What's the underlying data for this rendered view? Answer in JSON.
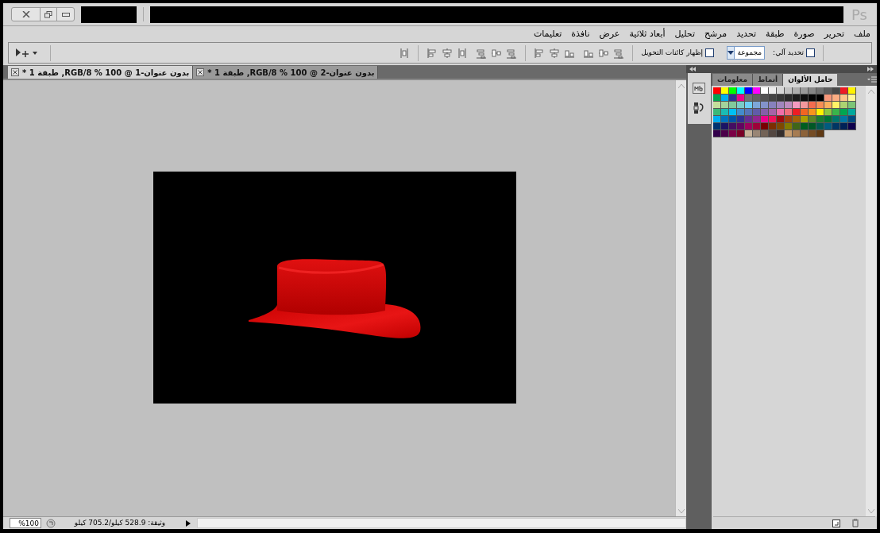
{
  "title_bar": {
    "logo": "Ps"
  },
  "menu": [
    "ملف",
    "تحرير",
    "صورة",
    "طبقة",
    "تحديد",
    "مرشح",
    "تحليل",
    "أبعاد ثلاثية",
    "عرض",
    "نافذة",
    "تعليمات"
  ],
  "options_bar": {
    "auto_select": {
      "label": "تحديد آلي:",
      "checked": false
    },
    "auto_select_target": {
      "value": "مجموعة"
    },
    "show_transform": {
      "label": "إظهار كائنات التحويل",
      "checked": false
    }
  },
  "tabs": [
    {
      "label": "بدون عنوان-2 @ 100 % RGB/8, طبقة 1 *",
      "selected": false
    },
    {
      "label": "بدون عنوان-1 @ 100 % RGB/8, طبقة 1 *",
      "selected": true
    }
  ],
  "panel": {
    "tabs": [
      {
        "label": "حامل الألوان",
        "selected": true
      },
      {
        "label": "أنماط",
        "selected": false
      },
      {
        "label": "معلومات",
        "selected": false
      }
    ],
    "swatch_rows": [
      [
        {
          "color": "#ff0000"
        },
        {
          "color": "#ffff00"
        },
        {
          "color": "#00ff00"
        },
        {
          "color": "#00ffff"
        },
        {
          "color": "#0000ff"
        },
        {
          "color": "#ff00ff"
        },
        {
          "color": "#ffffff"
        },
        {
          "color": "#ebebeb"
        },
        {
          "color": "#d6d6d6"
        },
        {
          "color": "#c2c2c2"
        },
        {
          "color": "#adadad"
        },
        {
          "color": "#999999"
        },
        {
          "color": "#858585"
        },
        {
          "color": "#707070"
        },
        {
          "color": "#5c5c5c"
        },
        {
          "color": "#474747"
        },
        {
          "color": "#ed1c24"
        },
        {
          "color": "#fff200"
        }
      ],
      [
        {
          "color": "#00a651"
        },
        {
          "color": "#00aeef"
        },
        {
          "color": "#2e3192"
        },
        {
          "color": "#ec008c"
        },
        {
          "color": "#707070"
        },
        {
          "color": "#616161"
        },
        {
          "color": "#525252"
        },
        {
          "color": "#434343"
        },
        {
          "color": "#363636"
        },
        {
          "color": "#292929"
        },
        {
          "color": "#1c1c1c"
        },
        {
          "color": "#0f0f0f"
        },
        {
          "color": "#050505"
        },
        {
          "color": "#000000"
        },
        {
          "color": "#f7977a"
        },
        {
          "color": "#fbad82"
        },
        {
          "color": "#fdc68a"
        },
        {
          "color": "#fff799"
        }
      ],
      [
        {
          "color": "#c4df9b"
        },
        {
          "color": "#a3d39c"
        },
        {
          "color": "#82ca9c"
        },
        {
          "color": "#7accc8"
        },
        {
          "color": "#6dcff6"
        },
        {
          "color": "#7da7d9"
        },
        {
          "color": "#8393ca"
        },
        {
          "color": "#8781bd"
        },
        {
          "color": "#a186be"
        },
        {
          "color": "#bd8cbf"
        },
        {
          "color": "#f49ac1"
        },
        {
          "color": "#f5989d"
        },
        {
          "color": "#f26c4f"
        },
        {
          "color": "#f68e55"
        },
        {
          "color": "#fbaf5c"
        },
        {
          "color": "#fff467"
        },
        {
          "color": "#acd372"
        },
        {
          "color": "#7cc576"
        }
      ],
      [
        {
          "color": "#3bb878"
        },
        {
          "color": "#1abbb4"
        },
        {
          "color": "#00bff3"
        },
        {
          "color": "#438ccb"
        },
        {
          "color": "#5574b9"
        },
        {
          "color": "#605ca8"
        },
        {
          "color": "#855fa8"
        },
        {
          "color": "#a763a8"
        },
        {
          "color": "#f06eaa"
        },
        {
          "color": "#f26d7d"
        },
        {
          "color": "#ed1c24"
        },
        {
          "color": "#f26522"
        },
        {
          "color": "#f7941d"
        },
        {
          "color": "#fff200"
        },
        {
          "color": "#8dc73f"
        },
        {
          "color": "#39b54a"
        },
        {
          "color": "#00a651"
        },
        {
          "color": "#00a99d"
        }
      ],
      [
        {
          "color": "#00aeef"
        },
        {
          "color": "#0072bc"
        },
        {
          "color": "#0054a6"
        },
        {
          "color": "#2e3192"
        },
        {
          "color": "#662d91"
        },
        {
          "color": "#92278f"
        },
        {
          "color": "#ec008c"
        },
        {
          "color": "#ed145b"
        },
        {
          "color": "#9e0b0f"
        },
        {
          "color": "#a0410d"
        },
        {
          "color": "#a36209"
        },
        {
          "color": "#aba000"
        },
        {
          "color": "#598527"
        },
        {
          "color": "#197b30"
        },
        {
          "color": "#007236"
        },
        {
          "color": "#00746b"
        },
        {
          "color": "#0076a3"
        },
        {
          "color": "#004a80"
        }
      ],
      [
        {
          "color": "#003471"
        },
        {
          "color": "#1b1464"
        },
        {
          "color": "#440e62"
        },
        {
          "color": "#630460"
        },
        {
          "color": "#9e005d"
        },
        {
          "color": "#9e0039"
        },
        {
          "color": "#790000"
        },
        {
          "color": "#7b2e00"
        },
        {
          "color": "#7d4900"
        },
        {
          "color": "#827b00"
        },
        {
          "color": "#406618"
        },
        {
          "color": "#005e20"
        },
        {
          "color": "#005826"
        },
        {
          "color": "#005952"
        },
        {
          "color": "#005b7f"
        },
        {
          "color": "#003663"
        },
        {
          "color": "#002157"
        },
        {
          "color": "#0d004c"
        }
      ],
      [
        {
          "color": "#32004b"
        },
        {
          "color": "#4b0049"
        },
        {
          "color": "#7b0046"
        },
        {
          "color": "#7a0026"
        },
        {
          "color": "#c7b299"
        },
        {
          "color": "#998675"
        },
        {
          "color": "#736357"
        },
        {
          "color": "#534741"
        },
        {
          "color": "#362f2d"
        },
        {
          "color": "#c69c6d"
        },
        {
          "color": "#a67c52"
        },
        {
          "color": "#8c6239"
        },
        {
          "color": "#754c24"
        },
        {
          "color": "#603913"
        }
      ]
    ]
  },
  "status_bar": {
    "zoom": "%100",
    "document": "وثيقة: 528.9 كيلو/705.2 كيلو"
  }
}
